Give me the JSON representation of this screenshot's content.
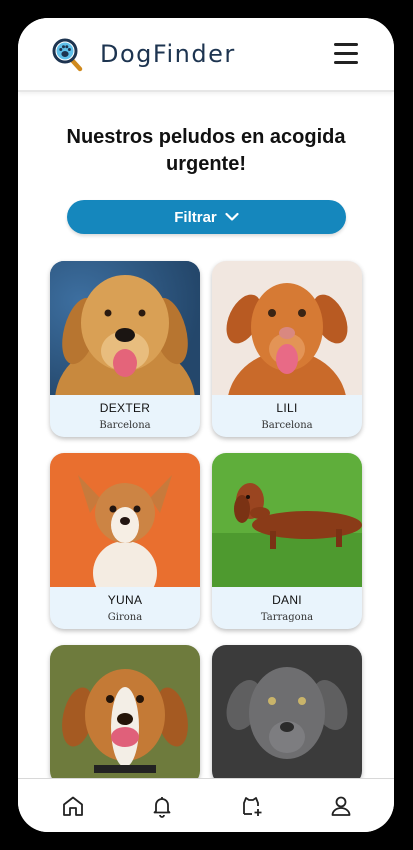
{
  "header": {
    "brand": "DogFinder",
    "logo_icon": "magnifier-paw-icon",
    "menu_icon": "hamburger-menu-icon"
  },
  "main": {
    "title": "Nuestros peludos en acogida urgente!",
    "filter_label": "Filtrar",
    "filter_icon": "chevron-down-icon"
  },
  "dogs": [
    {
      "name": "DEXTER",
      "city": "Barcelona",
      "bg": "#2f5d8a"
    },
    {
      "name": "LILI",
      "city": "Barcelona",
      "bg": "#f1e7e0"
    },
    {
      "name": "YUNA",
      "city": "Girona",
      "bg": "#e96f2f"
    },
    {
      "name": "DANI",
      "city": "Tarragona",
      "bg": "#5fae3b"
    },
    {
      "name": "",
      "city": "",
      "bg": "#6e7b3d"
    },
    {
      "name": "",
      "city": "",
      "bg": "#3b3b3b"
    }
  ],
  "bottom_nav": [
    {
      "icon": "home-icon"
    },
    {
      "icon": "bell-icon"
    },
    {
      "icon": "add-dog-icon"
    },
    {
      "icon": "profile-icon"
    }
  ],
  "colors": {
    "accent": "#1587bd",
    "brand_text": "#1d3450",
    "card_bg": "#e9f4fc"
  }
}
